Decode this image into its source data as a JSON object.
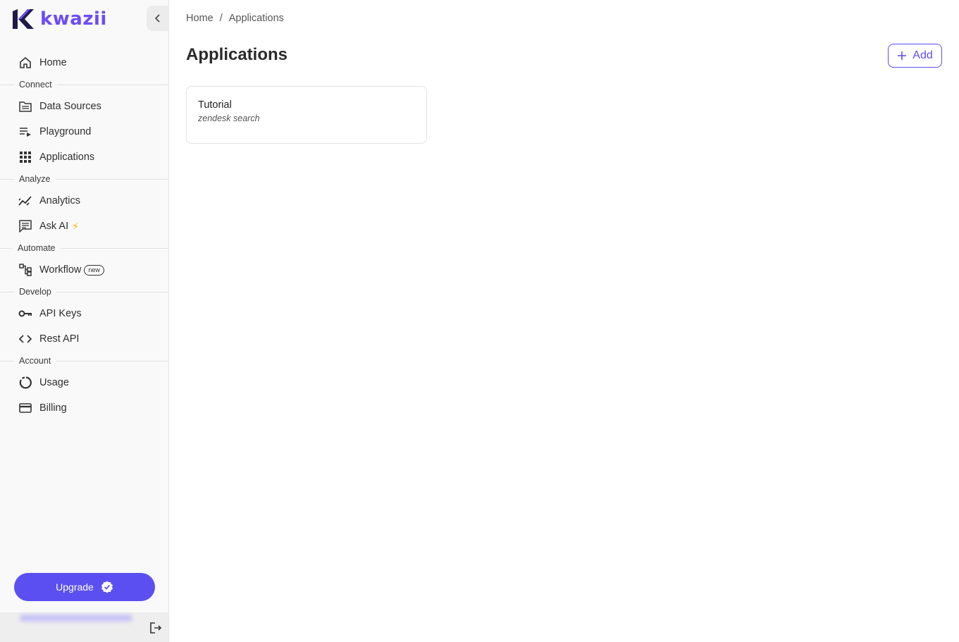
{
  "brand": {
    "name": "kwazii",
    "accent": "#6b4cf6",
    "button_color": "#5b4ff1"
  },
  "sidebar": {
    "home": {
      "label": "Home",
      "icon": "home-icon"
    },
    "sections": [
      {
        "title": "Connect",
        "items": [
          {
            "label": "Data Sources",
            "icon": "folder-icon"
          },
          {
            "label": "Playground",
            "icon": "playlist-play-icon"
          },
          {
            "label": "Applications",
            "icon": "grid-icon"
          }
        ]
      },
      {
        "title": "Analyze",
        "items": [
          {
            "label": "Analytics",
            "icon": "analytics-icon"
          },
          {
            "label": "Ask AI",
            "icon": "chat-icon",
            "suffix": "⚡"
          }
        ]
      },
      {
        "title": "Automate",
        "items": [
          {
            "label": "Workflow",
            "icon": "workflow-icon",
            "badge": "new"
          }
        ]
      },
      {
        "title": "Develop",
        "items": [
          {
            "label": "API Keys",
            "icon": "key-icon"
          },
          {
            "label": "Rest API",
            "icon": "code-icon"
          }
        ]
      },
      {
        "title": "Account",
        "items": [
          {
            "label": "Usage",
            "icon": "usage-ring-icon"
          },
          {
            "label": "Billing",
            "icon": "credit-card-icon"
          }
        ]
      }
    ],
    "upgrade_label": "Upgrade"
  },
  "breadcrumb": {
    "home": "Home",
    "separator": "/",
    "current": "Applications"
  },
  "page": {
    "title": "Applications",
    "add_label": "Add"
  },
  "cards": [
    {
      "title": "Tutorial",
      "subtitle": "zendesk search"
    }
  ]
}
